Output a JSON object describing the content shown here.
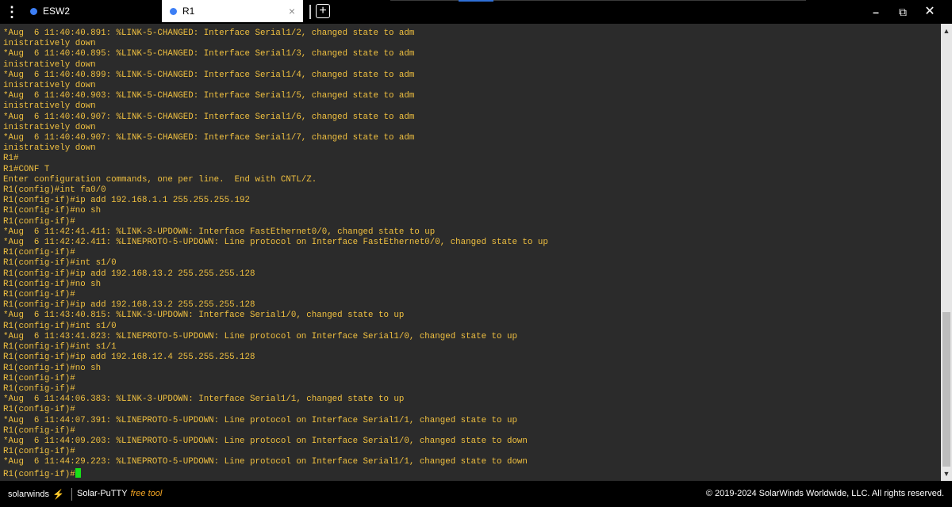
{
  "tabs": [
    {
      "label": "ESW2",
      "active": false
    },
    {
      "label": "R1",
      "active": true
    }
  ],
  "tab_close_glyph": "×",
  "tab_add_glyph": "+",
  "window_controls": {
    "minimize": "–",
    "maximize": "⧉",
    "close": "✕"
  },
  "colors": {
    "terminal_bg": "#2b2b2b",
    "terminal_fg": "#f0c040",
    "cursor": "#19e119",
    "brand_accent": "#f5a623",
    "tab_dot": "#3d7ff5"
  },
  "terminal": {
    "lines": [
      "*Aug  6 11:40:40.891: %LINK-5-CHANGED: Interface Serial1/2, changed state to adm",
      "inistratively down",
      "*Aug  6 11:40:40.895: %LINK-5-CHANGED: Interface Serial1/3, changed state to adm",
      "inistratively down",
      "*Aug  6 11:40:40.899: %LINK-5-CHANGED: Interface Serial1/4, changed state to adm",
      "inistratively down",
      "*Aug  6 11:40:40.903: %LINK-5-CHANGED: Interface Serial1/5, changed state to adm",
      "inistratively down",
      "*Aug  6 11:40:40.907: %LINK-5-CHANGED: Interface Serial1/6, changed state to adm",
      "inistratively down",
      "*Aug  6 11:40:40.907: %LINK-5-CHANGED: Interface Serial1/7, changed state to adm",
      "inistratively down",
      "R1#",
      "R1#CONF T",
      "Enter configuration commands, one per line.  End with CNTL/Z.",
      "R1(config)#int fa0/0",
      "R1(config-if)#ip add 192.168.1.1 255.255.255.192",
      "R1(config-if)#no sh",
      "R1(config-if)#",
      "*Aug  6 11:42:41.411: %LINK-3-UPDOWN: Interface FastEthernet0/0, changed state to up",
      "*Aug  6 11:42:42.411: %LINEPROTO-5-UPDOWN: Line protocol on Interface FastEthernet0/0, changed state to up",
      "R1(config-if)#",
      "R1(config-if)#int s1/0",
      "R1(config-if)#ip add 192.168.13.2 255.255.255.128",
      "R1(config-if)#no sh",
      "R1(config-if)#",
      "R1(config-if)#ip add 192.168.13.2 255.255.255.128",
      "*Aug  6 11:43:40.815: %LINK-3-UPDOWN: Interface Serial1/0, changed state to up",
      "R1(config-if)#int s1/0",
      "*Aug  6 11:43:41.823: %LINEPROTO-5-UPDOWN: Line protocol on Interface Serial1/0, changed state to up",
      "R1(config-if)#int s1/1",
      "R1(config-if)#ip add 192.168.12.4 255.255.255.128",
      "R1(config-if)#no sh",
      "R1(config-if)#",
      "R1(config-if)#",
      "*Aug  6 11:44:06.383: %LINK-3-UPDOWN: Interface Serial1/1, changed state to up",
      "R1(config-if)#",
      "*Aug  6 11:44:07.391: %LINEPROTO-5-UPDOWN: Line protocol on Interface Serial1/1, changed state to up",
      "R1(config-if)#",
      "*Aug  6 11:44:09.203: %LINEPROTO-5-UPDOWN: Line protocol on Interface Serial1/0, changed state to down",
      "R1(config-if)#",
      "*Aug  6 11:44:29.223: %LINEPROTO-5-UPDOWN: Line protocol on Interface Serial1/1, changed state to down"
    ],
    "prompt": "R1(config-if)#"
  },
  "footer": {
    "brand": "solarwinds",
    "product": "Solar-PuTTY",
    "product_tag": "free tool",
    "copyright": "© 2019-2024 SolarWinds Worldwide, LLC. All rights reserved."
  }
}
